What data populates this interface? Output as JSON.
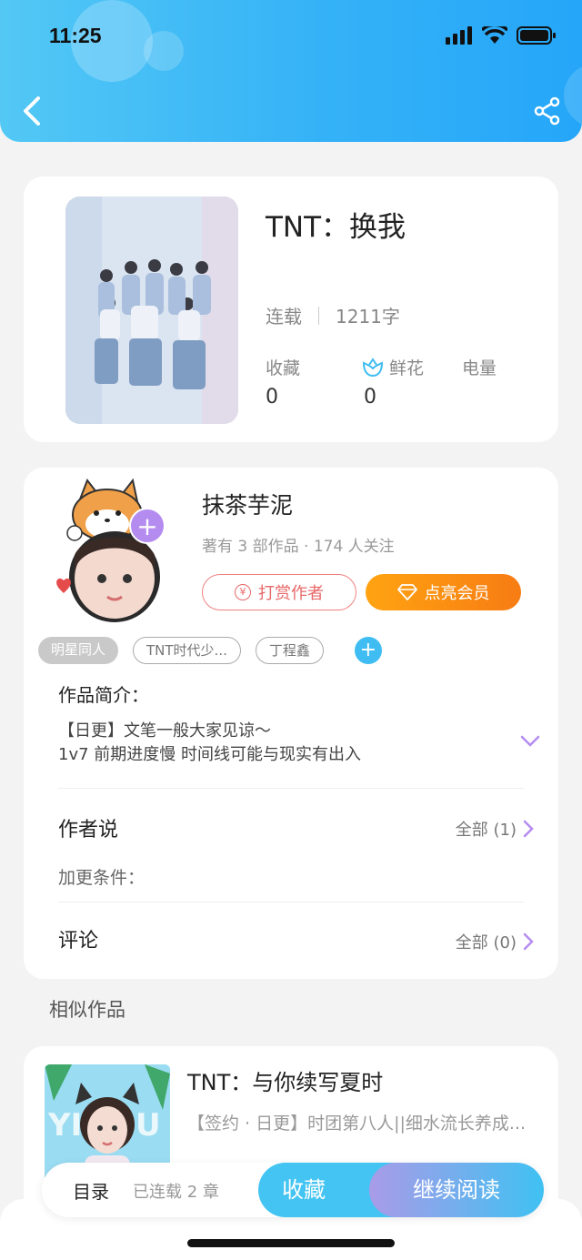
{
  "status_bar": {
    "time": "11:25"
  },
  "book": {
    "title": "TNT：换我",
    "status": "连载",
    "word_count": "1211字",
    "stats": [
      {
        "label": "收藏",
        "value": "0"
      },
      {
        "label": "鲜花",
        "value": "0",
        "icon": "flower-icon"
      },
      {
        "label": "电量",
        "value": ""
      }
    ]
  },
  "author": {
    "name": "抹茶芋泥",
    "meta": "著有 3 部作品 · 174 人关注",
    "reward_label": "打赏作者",
    "vip_label": "点亮会员",
    "follow_icon": "+"
  },
  "tags": [
    "明星同人",
    "TNT时代少...",
    "丁程鑫"
  ],
  "intro": {
    "title": "作品简介：",
    "lines": [
      "【日更】文笔一般大家见谅～",
      "1v7 前期进度慢 时间线可能与现实有出入"
    ]
  },
  "author_says": {
    "title": "作者说",
    "more": "全部 (1)",
    "sub": "加更条件："
  },
  "comments": {
    "title": "评论",
    "more": "全部 (0)"
  },
  "similar": {
    "section_title": "相似作品",
    "items": [
      {
        "title": "TNT：与你续写夏时",
        "desc": "【签约 · 日更】时团第八人||细水流长养成..."
      }
    ]
  },
  "bottom_bar": {
    "toc": "目录",
    "chapters": "已连载 2 章",
    "favorite": "收藏",
    "continue": "继续阅读"
  },
  "colors": {
    "accent_blue": "#35b2f7",
    "vip_orange": "#f77c13",
    "reward_red": "#e86868"
  }
}
